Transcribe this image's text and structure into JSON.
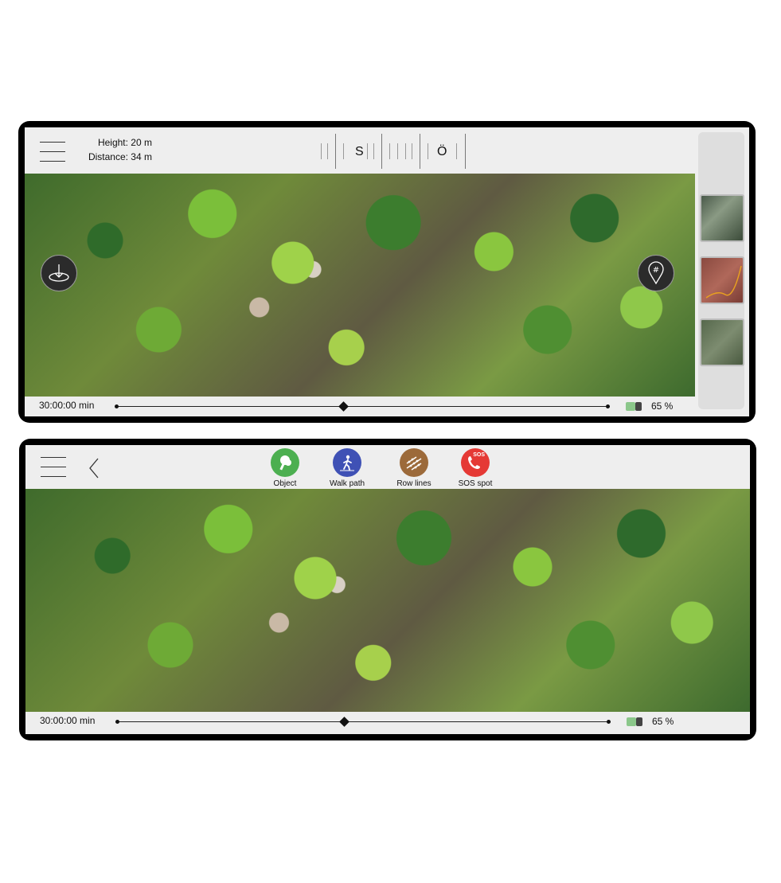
{
  "screen1": {
    "height_label": "Height: 20 m",
    "distance_label": "Distance: 34 m",
    "compass": {
      "left_letter": "S",
      "right_letter": "Ö"
    },
    "time": "30:00:00 min",
    "battery_percent": "65 %",
    "battery_level": 0.65,
    "slider_position": 0.46,
    "thumbnails": [
      "satellite-view",
      "terrain-view",
      "hybrid-view"
    ]
  },
  "screen2": {
    "toolbar": [
      {
        "label": "Object",
        "color": "#4caf50",
        "icon": "tree-icon"
      },
      {
        "label": "Walk path",
        "color": "#3f51b5",
        "icon": "walker-icon"
      },
      {
        "label": "Row lines",
        "color": "#9c6a3a",
        "icon": "row-lines-icon"
      },
      {
        "label": "SOS spot",
        "color": "#e53935",
        "icon": "sos-phone-icon",
        "badge": "SOS"
      }
    ],
    "time": "30:00:00 min",
    "battery_percent": "65 %",
    "battery_level": 0.65,
    "slider_position": 0.46
  },
  "colors": {
    "frame": "#000000",
    "bar_background": "#eeeeee",
    "battery_fill": "#8bc78a",
    "battery_dark": "#444444"
  }
}
